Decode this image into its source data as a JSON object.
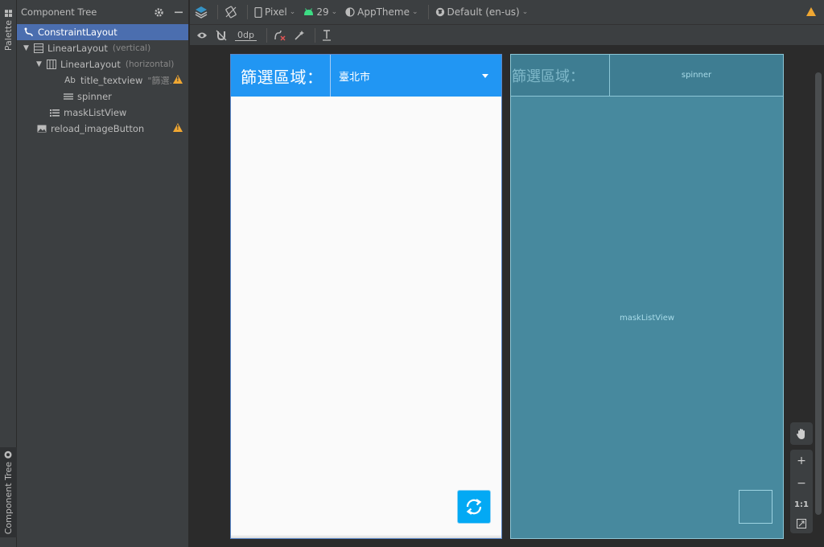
{
  "side_tabs": {
    "palette": "Palette",
    "component_tree": "Component Tree"
  },
  "tree": {
    "title": "Component Tree",
    "rows": [
      {
        "name": "ConstraintLayout",
        "type": "",
        "icon": "constraint-icon"
      },
      {
        "name": "LinearLayout",
        "type": "(vertical)",
        "icon": "vertical-layout-icon"
      },
      {
        "name": "LinearLayout",
        "type": "(horizontal)",
        "icon": "horizontal-layout-icon"
      },
      {
        "name": "title_textview",
        "type": "\"篩選...",
        "icon": "textview-icon",
        "icon_text": "Ab"
      },
      {
        "name": "spinner",
        "type": "",
        "icon": "spinner-icon"
      },
      {
        "name": "maskListView",
        "type": "",
        "icon": "list-icon"
      },
      {
        "name": "reload_imageButton",
        "type": "",
        "icon": "image-icon"
      }
    ]
  },
  "toolbar": {
    "device": "Pixel",
    "api": "29",
    "theme": "AppTheme",
    "locale": "Default (en-us)",
    "margin": "0dp"
  },
  "design": {
    "label": "篩選區域：",
    "spinner_value": "臺北市"
  },
  "blueprint": {
    "label": "篩選區域：",
    "spinner": "spinner",
    "list": "maskListView"
  },
  "zoom": {
    "plus": "+",
    "minus": "−",
    "one_to_one": "1:1"
  },
  "colors": {
    "accent": "#2196f3",
    "fab": "#03a9f4",
    "blueprint": "#47899e",
    "selection": "#4b6eaf",
    "warning": "#f0a732"
  }
}
